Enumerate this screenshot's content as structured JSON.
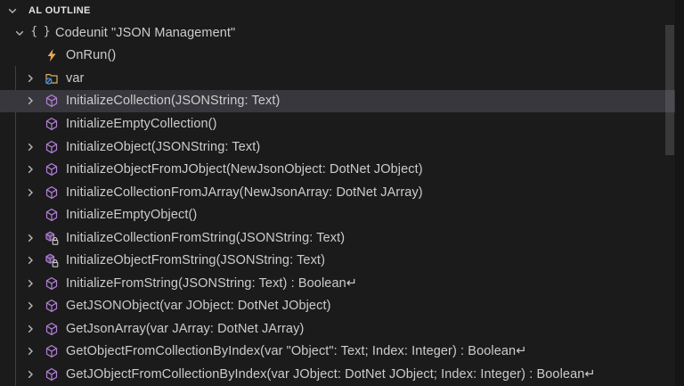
{
  "panel": {
    "header": {
      "title": "AL OUTLINE",
      "chevron": "down"
    }
  },
  "colors": {
    "background": "#1b1b1c",
    "header_text": "#e3e3e3",
    "text": "#cccccc",
    "row_selected": "#37373d",
    "indent_guide": "#3f3f46",
    "braces_icon": "#c5c5c5",
    "method_icon": "#b180d7",
    "event_icon": "#e8ab53",
    "var_folder_icon": "#d7b264",
    "var_accent_icon": "#4f8fd7",
    "lock_icon": "#cfcfcf",
    "chevron": "#b8b8b8",
    "edge_strip": "#151516"
  },
  "tree": {
    "rows": [
      {
        "label": "Codeunit \"JSON Management\"",
        "icon": "braces-icon",
        "chevron": "down",
        "level": 0,
        "selected": false
      },
      {
        "label": "OnRun()",
        "icon": "event-icon",
        "chevron": "none",
        "level": 1,
        "selected": false
      },
      {
        "label": "var",
        "icon": "variables-icon",
        "chevron": "right",
        "level": 1,
        "selected": false
      },
      {
        "label": "InitializeCollection(JSONString: Text)",
        "icon": "method-icon",
        "chevron": "right",
        "level": 1,
        "selected": true
      },
      {
        "label": "InitializeEmptyCollection()",
        "icon": "method-icon",
        "chevron": "none",
        "level": 1,
        "selected": false
      },
      {
        "label": "InitializeObject(JSONString: Text)",
        "icon": "method-icon",
        "chevron": "right",
        "level": 1,
        "selected": false
      },
      {
        "label": "InitializeObjectFromJObject(NewJsonObject: DotNet JObject)",
        "icon": "method-icon",
        "chevron": "right",
        "level": 1,
        "selected": false
      },
      {
        "label": "InitializeCollectionFromJArray(NewJsonArray: DotNet JArray)",
        "icon": "method-icon",
        "chevron": "right",
        "level": 1,
        "selected": false
      },
      {
        "label": "InitializeEmptyObject()",
        "icon": "method-icon",
        "chevron": "none",
        "level": 1,
        "selected": false
      },
      {
        "label": "InitializeCollectionFromString(JSONString: Text)",
        "icon": "method-lock-icon",
        "chevron": "right",
        "level": 1,
        "selected": false
      },
      {
        "label": "InitializeObjectFromString(JSONString: Text)",
        "icon": "method-lock-icon",
        "chevron": "right",
        "level": 1,
        "selected": false
      },
      {
        "label": "InitializeFromString(JSONString: Text) : Boolean↵",
        "icon": "method-icon",
        "chevron": "right",
        "level": 1,
        "selected": false
      },
      {
        "label": "GetJSONObject(var JObject: DotNet JObject)",
        "icon": "method-icon",
        "chevron": "right",
        "level": 1,
        "selected": false
      },
      {
        "label": "GetJsonArray(var JArray: DotNet JArray)",
        "icon": "method-icon",
        "chevron": "right",
        "level": 1,
        "selected": false
      },
      {
        "label": "GetObjectFromCollectionByIndex(var \"Object\": Text; Index: Integer) : Boolean↵",
        "icon": "method-icon",
        "chevron": "right",
        "level": 1,
        "selected": false
      },
      {
        "label": "GetJObjectFromCollectionByIndex(var JObject: DotNet JObject; Index: Integer) : Boolean↵",
        "icon": "method-icon",
        "chevron": "right",
        "level": 1,
        "selected": false
      }
    ]
  },
  "scrollbar": {
    "visible": true
  }
}
